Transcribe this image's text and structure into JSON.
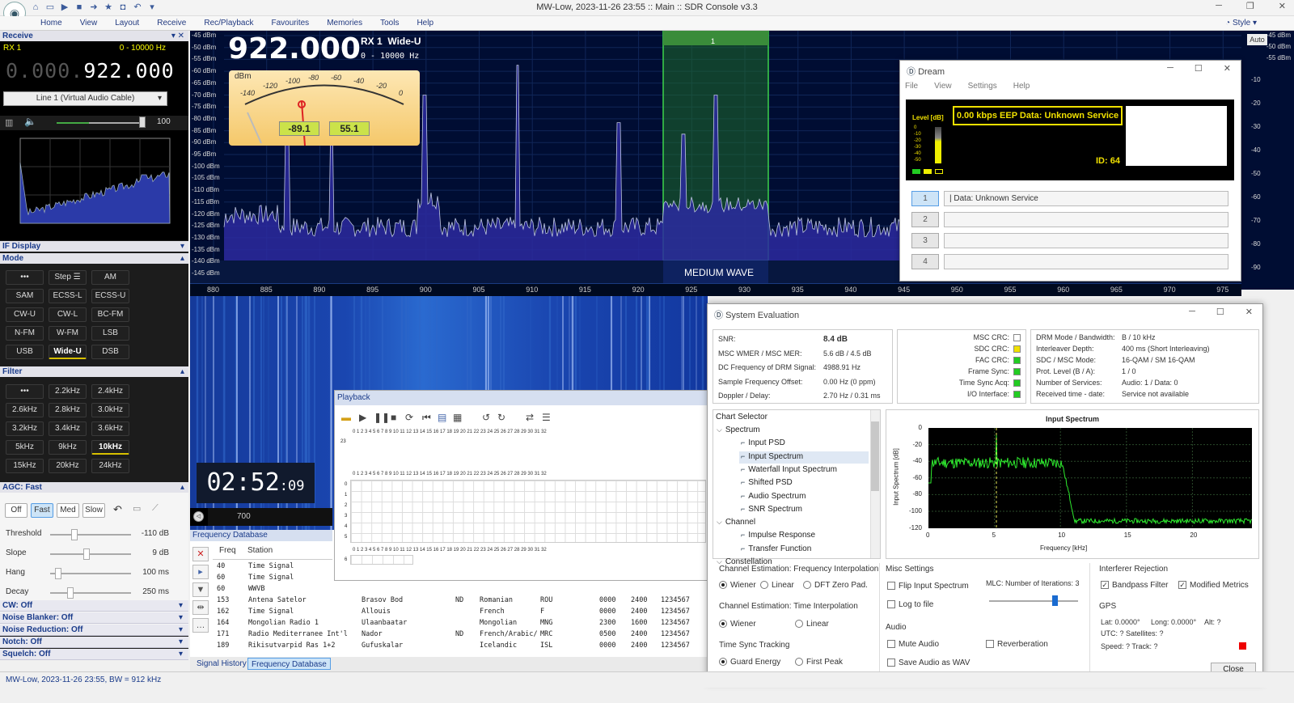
{
  "window": {
    "title": "MW-Low, 2023-11-26 23:55 :: Main :: SDR Console v3.3",
    "style_label": "Style",
    "menu": [
      "Home",
      "View",
      "Layout",
      "Receive",
      "Rec/Playback",
      "Favourites",
      "Memories",
      "Tools",
      "Help"
    ]
  },
  "left": {
    "receive_header": "Receive",
    "rx_label": "RX 1",
    "rx_range": "0 - 10000 Hz",
    "freq_dim": "0.000.",
    "freq_main": "922.000",
    "audio_device": "Line 1 (Virtual Audio Cable)",
    "volume": "100",
    "if_display": "IF Display",
    "mode_header": "Mode",
    "modes": [
      "•••",
      "Step ☰",
      "AM",
      "SAM",
      "ECSS-L",
      "ECSS-U",
      "CW-U",
      "CW-L",
      "BC-FM",
      "N-FM",
      "W-FM",
      "LSB",
      "USB",
      "Wide-U",
      "DSB"
    ],
    "filter_header": "Filter",
    "filters": [
      "•••",
      "2.2kHz",
      "2.4kHz",
      "2.6kHz",
      "2.8kHz",
      "3.0kHz",
      "3.2kHz",
      "3.4kHz",
      "3.6kHz",
      "5kHz",
      "9kHz",
      "10kHz",
      "15kHz",
      "20kHz",
      "24kHz"
    ],
    "agc_header": "AGC: Fast",
    "agc_buttons": [
      "Off",
      "Fast",
      "Med",
      "Slow"
    ],
    "agc_params": [
      {
        "label": "Threshold",
        "value": "-110 dB"
      },
      {
        "label": "Slope",
        "value": "9 dB"
      },
      {
        "label": "Hang",
        "value": "100 ms"
      },
      {
        "label": "Decay",
        "value": "250 ms"
      }
    ],
    "sections": [
      "CW: Off",
      "Noise Blanker: Off",
      "Noise Reduction: Off",
      "Notch: Off",
      "Squelch: Off"
    ]
  },
  "spectrum": {
    "freq": "922.000",
    "rx": "RX 1",
    "mode": "Wide-U",
    "range": "0 - 10000 Hz",
    "dbm_unit": "dBm",
    "meter_readings": [
      "-89.1",
      "55.1"
    ],
    "meter_scale": [
      "-140",
      "-120",
      "-100",
      "-80",
      "-60",
      "-40",
      "-20",
      "0"
    ],
    "y_ticks": [
      "-45 dBm",
      "-50 dBm",
      "-55 dBm",
      "-60 dBm",
      "-65 dBm",
      "-70 dBm",
      "-75 dBm",
      "-80 dBm",
      "-85 dBm",
      "-90 dBm",
      "-95 dBm",
      "-100 dBm",
      "-105 dBm",
      "-110 dBm",
      "-115 dBm",
      "-120 dBm",
      "-125 dBm",
      "-130 dBm",
      "-135 dBm",
      "-140 dBm",
      "-145 dBm"
    ],
    "x_ticks": [
      "880",
      "885",
      "890",
      "895",
      "900",
      "905",
      "910",
      "915",
      "920",
      "925",
      "930",
      "935",
      "940",
      "945",
      "950",
      "955",
      "960",
      "965",
      "970",
      "975"
    ],
    "band_label": "MEDIUM WAVE",
    "marker": "1",
    "right_ticks": [
      "-45 dBm",
      "-50 dBm",
      "-55 dBm"
    ],
    "right_scale": [
      "-10",
      "-20",
      "-30",
      "-40",
      "-50",
      "-60",
      "-70",
      "-80",
      "-90"
    ],
    "auto_label": "Auto",
    "clock": "02:52",
    "clock_sec": ":09",
    "wf_label": "700"
  },
  "dream": {
    "title": "Dream",
    "menu": [
      "File",
      "View",
      "Settings",
      "Help"
    ],
    "level_label": "Level [dB]",
    "level_ticks": [
      "0",
      "-10",
      "-20",
      "-30",
      "-40",
      "-50"
    ],
    "service_line": "0.00 kbps EEP Data: Unknown Service",
    "id": "ID: 64",
    "services": [
      {
        "num": "1",
        "text": "|  Data: Unknown Service"
      },
      {
        "num": "2",
        "text": ""
      },
      {
        "num": "3",
        "text": ""
      },
      {
        "num": "4",
        "text": ""
      }
    ]
  },
  "sysev": {
    "title": "System Evaluation",
    "metrics": [
      {
        "k": "SNR:",
        "v": "8.4 dB"
      },
      {
        "k": "MSC WMER / MSC MER:",
        "v": "5.6 dB / 4.5 dB"
      },
      {
        "k": "DC Frequency of DRM Signal:",
        "v": "4988.91 Hz"
      },
      {
        "k": "Sample Frequency Offset:",
        "v": "0.00 Hz (0 ppm)"
      },
      {
        "k": "Doppler / Delay:",
        "v": "2.70 Hz / 0.31 ms"
      }
    ],
    "crc": [
      {
        "k": "MSC CRC:",
        "color": "#ffffff"
      },
      {
        "k": "SDC CRC:",
        "color": "#f0e000"
      },
      {
        "k": "FAC CRC:",
        "color": "#22cc22"
      },
      {
        "k": "Frame Sync:",
        "color": "#22cc22"
      },
      {
        "k": "Time Sync Acq:",
        "color": "#22cc22"
      },
      {
        "k": "I/O Interface:",
        "color": "#22cc22"
      }
    ],
    "drm": [
      {
        "k": "DRM Mode / Bandwidth:",
        "v": "B / 10 kHz"
      },
      {
        "k": "Interleaver Depth:",
        "v": "400 ms (Short Interleaving)"
      },
      {
        "k": "SDC / MSC Mode:",
        "v": "16-QAM / SM 16-QAM"
      },
      {
        "k": "Prot. Level (B / A):",
        "v": "1 / 0"
      },
      {
        "k": "Number of Services:",
        "v": "Audio: 1 / Data: 0"
      },
      {
        "k": "Received time - date:",
        "v": "Service not available"
      }
    ],
    "chart_selector": "Chart Selector",
    "tree": [
      {
        "label": "Spectrum",
        "level": 0
      },
      {
        "label": "Input PSD",
        "level": 1
      },
      {
        "label": "Input Spectrum",
        "level": 1
      },
      {
        "label": "Waterfall Input Spectrum",
        "level": 1
      },
      {
        "label": "Shifted PSD",
        "level": 1
      },
      {
        "label": "Audio Spectrum",
        "level": 1
      },
      {
        "label": "SNR Spectrum",
        "level": 1
      },
      {
        "label": "Channel",
        "level": 0
      },
      {
        "label": "Impulse Response",
        "level": 1
      },
      {
        "label": "Transfer Function",
        "level": 1
      },
      {
        "label": "Constellation",
        "level": 0
      }
    ],
    "chart_title": "Input Spectrum",
    "chart_ylabel": "Input Spectrum [dB]",
    "chart_xlabel": "Frequency [kHz]",
    "chart_yticks": [
      "0",
      "-20",
      "-40",
      "-60",
      "-80",
      "-100",
      "-120"
    ],
    "chart_xticks": [
      "0",
      "5",
      "10",
      "15",
      "20"
    ],
    "ce_freq_title": "Channel Estimation: Frequency Interpolation",
    "ce_freq": [
      "Wiener",
      "Linear",
      "DFT Zero Pad."
    ],
    "ce_time_title": "Channel Estimation: Time Interpolation",
    "ce_time": [
      "Wiener",
      "Linear"
    ],
    "tst_title": "Time Sync Tracking",
    "tst": [
      "Guard Energy",
      "First Peak"
    ],
    "misc_title": "Misc Settings",
    "flip": "Flip Input Spectrum",
    "log": "Log to file",
    "mlc": "MLC: Number of Iterations: 3",
    "audio_title": "Audio",
    "mute": "Mute Audio",
    "reverb": "Reverberation",
    "save_audio": "Save Audio as WAV",
    "ir_title": "Interferer Rejection",
    "bandpass": "Bandpass Filter",
    "modmetrics": "Modified Metrics",
    "gps_title": "GPS",
    "gps_lat": "Lat: 0.0000°",
    "gps_long": "Long: 0.0000°",
    "gps_alt": "Alt: ?",
    "gps_utc": "UTC: ?  Satellites: ?",
    "gps_speed": "Speed: ?  Track: ?",
    "close": "Close"
  },
  "playback": {
    "title": "Playback",
    "hours_label": "0  1  2  3  4  5  6  7  8  9  10  11  12  13  14  15  16  17  18  19  20  21  22  23  24  25  26  27  28  29  30  31  32",
    "row_labels": [
      "0",
      "1",
      "2",
      "3",
      "4",
      "5",
      "6"
    ],
    "first_row": "23"
  },
  "fdb": {
    "title": "Frequency Database",
    "cols": [
      "Freq",
      "Station"
    ],
    "rows": [
      {
        "f": "40",
        "s": "Time Signal",
        "loc": "",
        "n": "",
        "lang": "",
        "c": "",
        "t1": "",
        "t2": "",
        "d": ""
      },
      {
        "f": "60",
        "s": "Time Signal",
        "loc": "",
        "n": "",
        "lang": "",
        "c": "",
        "t1": "",
        "t2": "",
        "d": ""
      },
      {
        "f": "60",
        "s": "WWVB",
        "loc": "",
        "n": "",
        "lang": "",
        "c": "",
        "t1": "",
        "t2": "",
        "d": ""
      },
      {
        "f": "153",
        "s": "Antena Satelor",
        "loc": "Brasov Bod",
        "n": "ND",
        "lang": "Romanian",
        "c": "ROU",
        "t1": "0000",
        "t2": "2400",
        "d": "1234567"
      },
      {
        "f": "162",
        "s": "Time Signal",
        "loc": "Allouis",
        "n": "",
        "lang": "French",
        "c": "F",
        "t1": "0000",
        "t2": "2400",
        "d": "1234567"
      },
      {
        "f": "164",
        "s": "Mongolian Radio 1",
        "loc": "Ulaanbaatar",
        "n": "",
        "lang": "Mongolian",
        "c": "MNG",
        "t1": "2300",
        "t2": "1600",
        "d": "1234567"
      },
      {
        "f": "171",
        "s": "Radio Mediterranee Int'l",
        "loc": "Nador",
        "n": "ND",
        "lang": "French/Arabic/",
        "c": "MRC",
        "t1": "0500",
        "t2": "2400",
        "d": "1234567"
      },
      {
        "f": "189",
        "s": "Rikisutvarpid Ras 1+2",
        "loc": "Gufuskalar",
        "n": "",
        "lang": "Icelandic",
        "c": "ISL",
        "t1": "0000",
        "t2": "2400",
        "d": "1234567"
      }
    ],
    "tabs": [
      "Signal History",
      "Frequency Database"
    ]
  },
  "status": "MW-Low, 2023-11-26 23:55, BW = 912 kHz"
}
